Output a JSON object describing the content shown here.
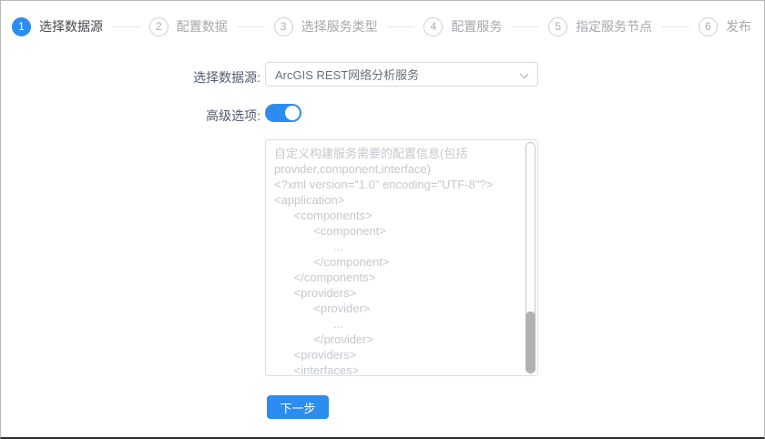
{
  "steps": [
    {
      "number": "1",
      "label": "选择数据源",
      "state": "active"
    },
    {
      "number": "2",
      "label": "配置数据",
      "state": "pending"
    },
    {
      "number": "3",
      "label": "选择服务类型",
      "state": "pending"
    },
    {
      "number": "4",
      "label": "配置服务",
      "state": "pending"
    },
    {
      "number": "5",
      "label": "指定服务节点",
      "state": "pending"
    },
    {
      "number": "6",
      "label": "发布",
      "state": "pending"
    }
  ],
  "form": {
    "datasource_label": "选择数据源:",
    "datasource_value": "ArcGIS REST网络分析服务",
    "advanced_label": "高级选项:",
    "advanced_on": true,
    "config_placeholder": "自定义构建服务需要的配置信息(包括\nprovider,component,interface)\n<?xml version=\"1.0\" encoding=\"UTF-8\"?>\n<application>\n      <components>\n            <component>\n                  ...\n            </component>\n      </components>\n      <providers>\n            <provider>\n                  ...\n            </provider>\n      <providers>\n      <interfaces>"
  },
  "footer": {
    "next_label": "下一步"
  },
  "icons": {
    "select_arrow": "chevron-down-icon"
  },
  "colors": {
    "primary": "#2d8cf0",
    "step_inactive_border": "#cfcfcf",
    "step_inactive_text": "#a5a8ad",
    "placeholder_text": "#c5c8ce",
    "scrollbar_thumb": "#b2b2b2"
  }
}
